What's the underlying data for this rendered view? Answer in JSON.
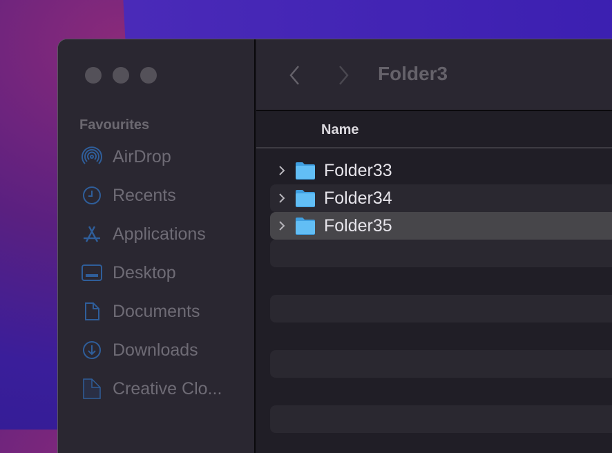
{
  "sidebar": {
    "section": "Favourites",
    "items": [
      {
        "label": "AirDrop",
        "icon": "airdrop-icon"
      },
      {
        "label": "Recents",
        "icon": "clock-icon"
      },
      {
        "label": "Applications",
        "icon": "applications-icon"
      },
      {
        "label": "Desktop",
        "icon": "desktop-icon"
      },
      {
        "label": "Documents",
        "icon": "document-icon"
      },
      {
        "label": "Downloads",
        "icon": "download-icon"
      },
      {
        "label": "Creative Clo...",
        "icon": "file-icon"
      }
    ]
  },
  "toolbar": {
    "title": "Folder3"
  },
  "list": {
    "header": "Name",
    "rows": [
      {
        "name": "Folder33"
      },
      {
        "name": "Folder34"
      },
      {
        "name": "Folder35",
        "selected": true
      }
    ]
  },
  "colors": {
    "accent_icon": "#2f5e9a",
    "selected_row": "#47464a",
    "folder": "#5ab8f0"
  }
}
